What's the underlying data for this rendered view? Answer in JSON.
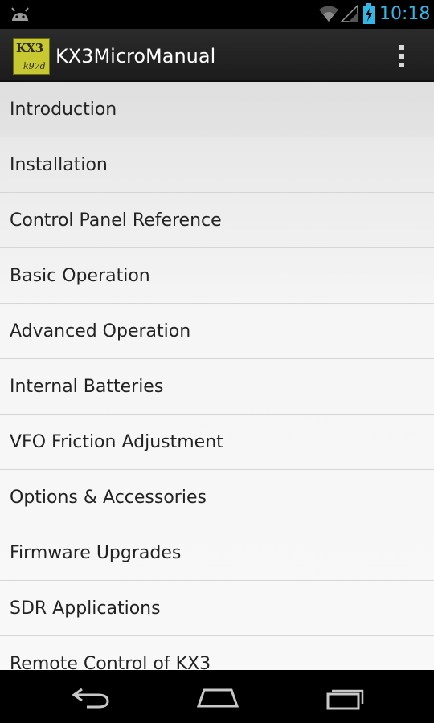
{
  "status_bar": {
    "time": "10:18",
    "icons": [
      "android-debug-icon",
      "wifi-icon",
      "signal-icon",
      "battery-charging-icon"
    ],
    "accent_color": "#33b5e5"
  },
  "action_bar": {
    "logo_text_top": "KX3",
    "logo_text_bottom": "k97d",
    "title": "KX3MicroManual",
    "overflow_icon": "overflow-menu-icon"
  },
  "menu": {
    "items": [
      {
        "label": "Introduction"
      },
      {
        "label": "Installation"
      },
      {
        "label": "Control Panel Reference"
      },
      {
        "label": "Basic Operation"
      },
      {
        "label": "Advanced Operation"
      },
      {
        "label": "Internal Batteries"
      },
      {
        "label": "VFO Friction Adjustment"
      },
      {
        "label": "Options & Accessories"
      },
      {
        "label": "Firmware Upgrades"
      },
      {
        "label": "SDR Applications"
      },
      {
        "label": "Remote Control of KX3"
      }
    ]
  },
  "nav_bar": {
    "buttons": [
      "back-icon",
      "home-icon",
      "recents-icon"
    ]
  }
}
